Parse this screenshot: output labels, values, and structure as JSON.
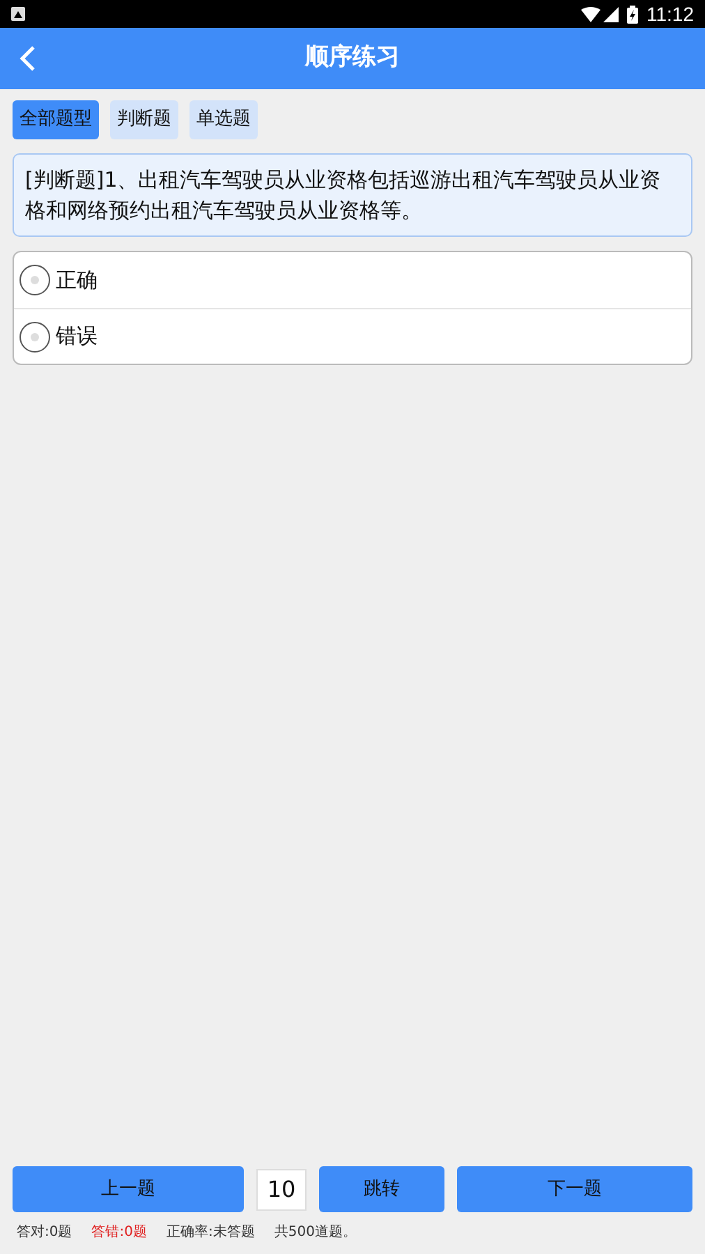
{
  "status_bar": {
    "time": "11:12"
  },
  "header": {
    "title": "顺序练习"
  },
  "tabs": [
    {
      "label": "全部题型",
      "selected": true
    },
    {
      "label": "判断题",
      "selected": false
    },
    {
      "label": "单选题",
      "selected": false
    }
  ],
  "question": {
    "text": "[判断题]1、出租汽车驾驶员从业资格包括巡游出租汽车驾驶员从业资格和网络预约出租汽车驾驶员从业资格等。"
  },
  "options": [
    {
      "label": "正确",
      "selected": false
    },
    {
      "label": "错误",
      "selected": false
    }
  ],
  "footer": {
    "prev_button": "上一题",
    "jump_value": "10",
    "jump_button": "跳转",
    "next_button": "下一题"
  },
  "stats": [
    {
      "text": "答对:0题",
      "color": "#333333"
    },
    {
      "text": "答错:0题",
      "color": "#e02020"
    },
    {
      "text": "正确率:未答题",
      "color": "#333333"
    },
    {
      "text": "共500道题。",
      "color": "#333333"
    }
  ]
}
